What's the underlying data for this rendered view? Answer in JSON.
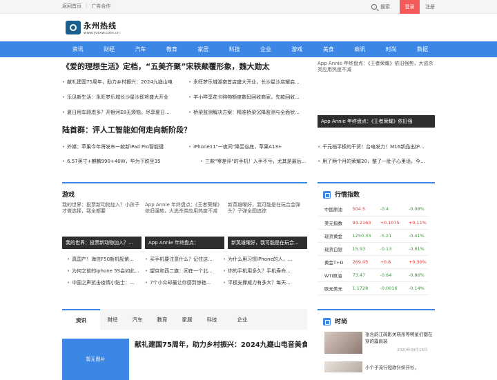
{
  "topbar": {
    "home": "返回首页",
    "ad": "广告合作",
    "search": "搜索",
    "login": "登录",
    "register": "注册"
  },
  "logo": {
    "name": "永州热线",
    "url": "www.yzrxw.com.cn"
  },
  "nav": [
    "资讯",
    "财经",
    "汽车",
    "教育",
    "家居",
    "科技",
    "企业",
    "游戏",
    "美食",
    "商讯",
    "时尚",
    "数据"
  ],
  "top": {
    "headline1": "《爱的理想生活》定档，“五美齐聚”宋轶颠覆形象，魏大勋太",
    "list1": [
      "献礼建国75周年，助力乡村振兴：2024九嶷山电",
      "乐见新生活：永旺梦乐城长沙星沙即将盛大开业",
      "夏日用车顾虑多？开银河E8无烦恼，尽享夏日...",
      "永旺梦乐城湖南首店盛大开业，长沙星沙店耀启...",
      "羊小咩享花卡购物额度数码回收商家，先款回收...",
      "桥梁监测解决方案：精准桥梁沉降监测与全面状..."
    ],
    "image_alt": "App Annie 年终盘点：《王者荣耀》依旧强势，大逃杀类应用热度不减",
    "image_cap": "App Annie 年终盘点：《王者荣耀》依旧强",
    "headline2": "陆首群：评人工智能如何走向新阶段？",
    "list2": [
      "外媒：苹果今年将发布一款新iPad Pro智能键",
      "iPhone11\"一夜间\"降至谷底，苹果A13+",
      "千元档平板的干货！台电发力！M16新品出炉...",
      "6.57英寸+麒麟990+40W，华为下跌至35",
      "三款\"零差评\"的手机！入手不亏，尤其是最后...",
      "用了两个月的荣耀20，整了一肚子心里话，今..."
    ]
  },
  "game": {
    "title": "游戏",
    "cards": [
      {
        "alt": "我的世界：投票新动物加入？小孩子才做选择，我全都要",
        "cap": "我的世界：投票新动物加入？..."
      },
      {
        "alt": "App Annie 年终盘点：《王者荣耀》依旧强势，大逃杀类应用热度不减",
        "cap": "App Annie 年终盘点："
      },
      {
        "alt": "新英雄曜好，我可能是在玩合金弹头？子弹全图追踪",
        "cap": "新英雄曜好，我可能是在玩合..."
      }
    ],
    "list": [
      [
        "真国产！海信F50新机配紫...",
        "买手机要注意什么？记住这...",
        "为什么用习惯iPhone的人，..."
      ],
      [
        "为何之前的iphone 5S会如此...",
        "望京和西二旗：同在一个北...",
        "你的手机用多久？手机寿命..."
      ],
      [
        "中国之声抗击疫情小贴士：...",
        "7个小众却最让你感到惊艳...",
        "平板支撑威力有多大？每天..."
      ]
    ]
  },
  "market": {
    "title": "行情指数",
    "rows": [
      [
        "中国原油",
        "504.5",
        "-0.4",
        "-0.08%"
      ],
      [
        "美元指数",
        "94.2163",
        "+0.1075",
        "+0.11%"
      ],
      [
        "现货黄金",
        "1250.33",
        "-5.21",
        "-0.41%"
      ],
      [
        "现货白银",
        "15.93",
        "-0.13",
        "-0.81%"
      ],
      [
        "黄金T+D",
        "269.05",
        "+0.8",
        "+0.30%"
      ],
      [
        "WTI原油",
        "73.47",
        "-0.64",
        "-0.86%"
      ],
      [
        "欧元美元",
        "1.1728",
        "-0.0016",
        "-0.14%"
      ]
    ]
  },
  "tabs": [
    "资讯",
    "财经",
    "汽车",
    "教育",
    "家居",
    "科技",
    "企业"
  ],
  "feature": {
    "noimg": "暂无图片",
    "title": "献礼建国75周年，助力乡村振兴：2024九嶷山电音美食..."
  },
  "fashion": {
    "title": "时尚",
    "items": [
      {
        "title": "张含韵江疏影关晓彤等明星们都在穿的露肩装",
        "date": "2020年09月16日"
      },
      {
        "title": "小个子流行短款针织开衫，",
        "date": ""
      }
    ]
  },
  "colors": {
    "accent": "#3c87e6",
    "login": "#f45a5a",
    "up": "#e33333",
    "down": "#3a9a3a"
  }
}
